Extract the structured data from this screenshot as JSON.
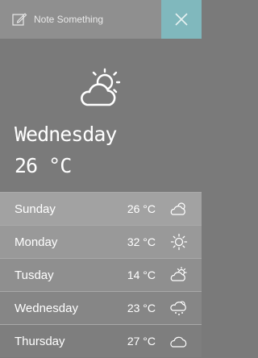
{
  "header": {
    "note_label": "Note Something"
  },
  "current": {
    "day": "Wednesday",
    "temperature": "26 °C",
    "icon": "partly-cloudy-icon"
  },
  "forecast": [
    {
      "day": "Sunday",
      "temp": "26 °C",
      "icon": "partly-cloudy-icon"
    },
    {
      "day": "Monday",
      "temp": "32 °C",
      "icon": "sun-icon"
    },
    {
      "day": "Tusday",
      "temp": "14 °C",
      "icon": "partly-cloudy-icon"
    },
    {
      "day": "Wednesday",
      "temp": "23 °C",
      "icon": "snow-cloud-icon"
    },
    {
      "day": "Thursday",
      "temp": "27 °C",
      "icon": "cloud-icon"
    }
  ],
  "colors": {
    "close_accent": "#80b8bd",
    "background": "#7a7a7a"
  }
}
